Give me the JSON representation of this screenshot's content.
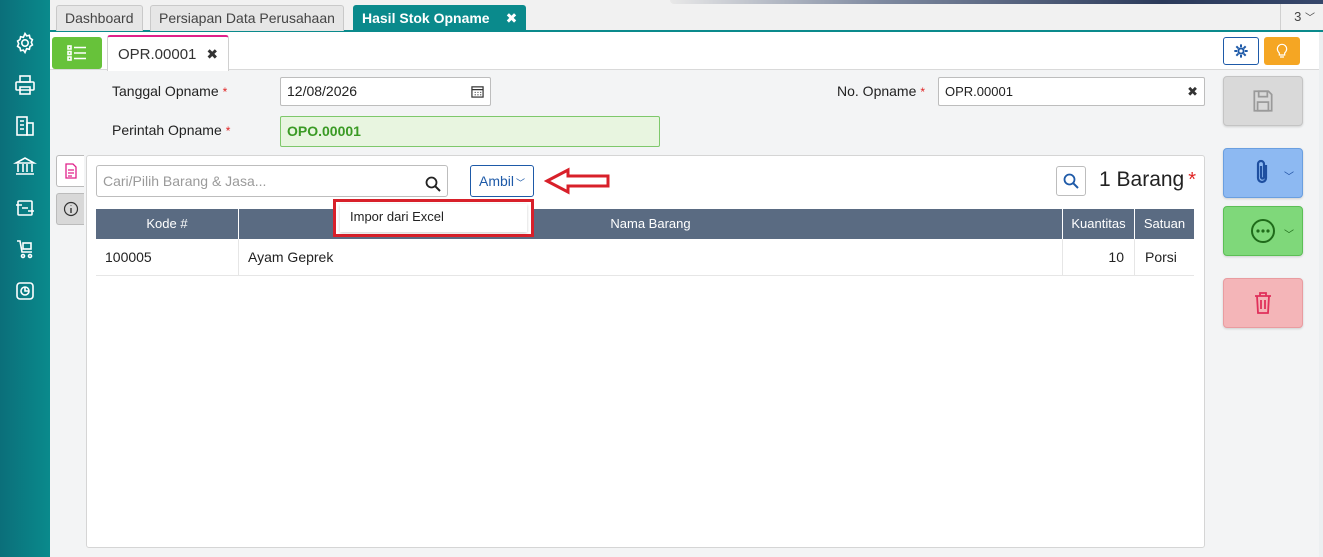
{
  "tabs": [
    {
      "label": "Dashboard",
      "active": false
    },
    {
      "label": "Persiapan Data Perusahaan",
      "active": false
    },
    {
      "label": "Hasil Stok Opname",
      "active": true
    }
  ],
  "tab_count": "3",
  "doc_tab": {
    "label": "OPR.00001"
  },
  "form": {
    "tanggal_label": "Tanggal Opname",
    "tanggal_value": "12/08/2026",
    "perintah_label": "Perintah Opname",
    "perintah_value": "OPO.00001",
    "no_label": "No. Opname",
    "no_value": "OPR.00001",
    "required_mark": "*"
  },
  "items": {
    "search_placeholder": "Cari/Pilih Barang & Jasa...",
    "ambil_label": "Ambil",
    "count_label": "1 Barang",
    "dropdown_item": "Impor dari Excel",
    "columns": [
      "Kode #",
      "Nama Barang",
      "Kuantitas",
      "Satuan"
    ],
    "rows": [
      {
        "kode": "100005",
        "nama": "Ayam Geprek",
        "qty": "10",
        "satuan": "Porsi"
      }
    ]
  },
  "colors": {
    "sidebar": "#0a8a8c",
    "active_tab": "#0a8a8c",
    "table_header": "#5a6b82",
    "highlight": "#d8202a"
  },
  "icons": [
    "gear-icon",
    "printer-icon",
    "building-icon",
    "bank-icon",
    "transfer-icon",
    "cart-icon",
    "report-icon",
    "list-icon",
    "settings-icon",
    "lightbulb-icon",
    "calendar-icon",
    "clear-icon",
    "document-icon",
    "info-icon",
    "search-icon",
    "chevron-down-icon",
    "arrow-left-icon",
    "save-icon",
    "paperclip-icon",
    "more-icon",
    "trash-icon"
  ]
}
